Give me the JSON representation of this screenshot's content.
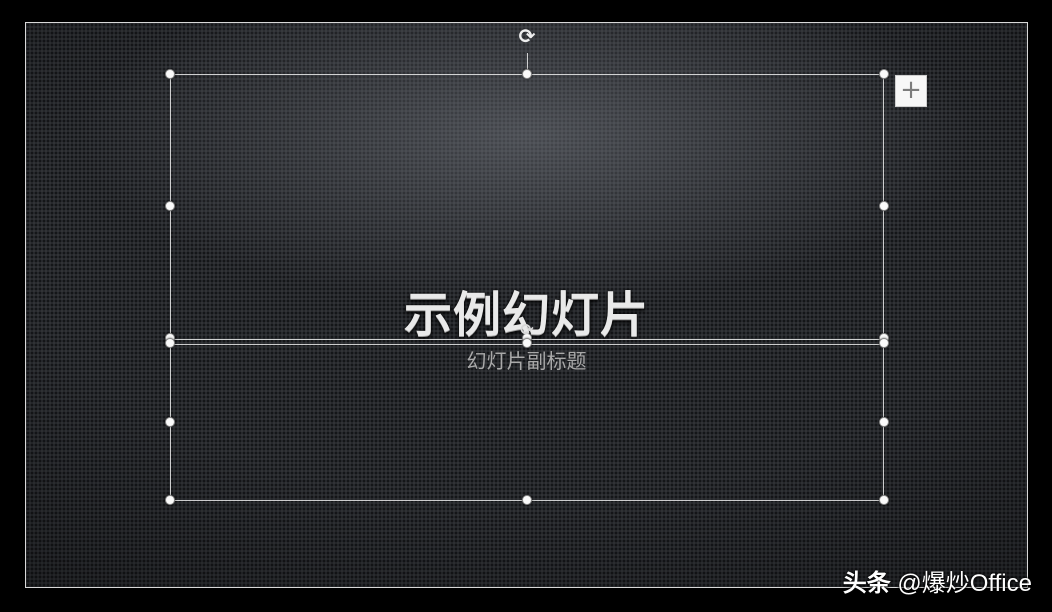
{
  "slide": {
    "title": "示例幻灯片",
    "subtitle": "幻灯片副标题"
  },
  "controls": {
    "add_button_symbol": "+",
    "rotate_symbol": "⟳"
  },
  "watermark": {
    "brand": "头条",
    "account": "@爆炒Office"
  },
  "colors": {
    "page_background": "#000000",
    "slide_background": "#26282c",
    "title_text": "#e9e9e9",
    "subtitle_text": "#a9a9a9",
    "selection_frame": "#ebebeb"
  }
}
